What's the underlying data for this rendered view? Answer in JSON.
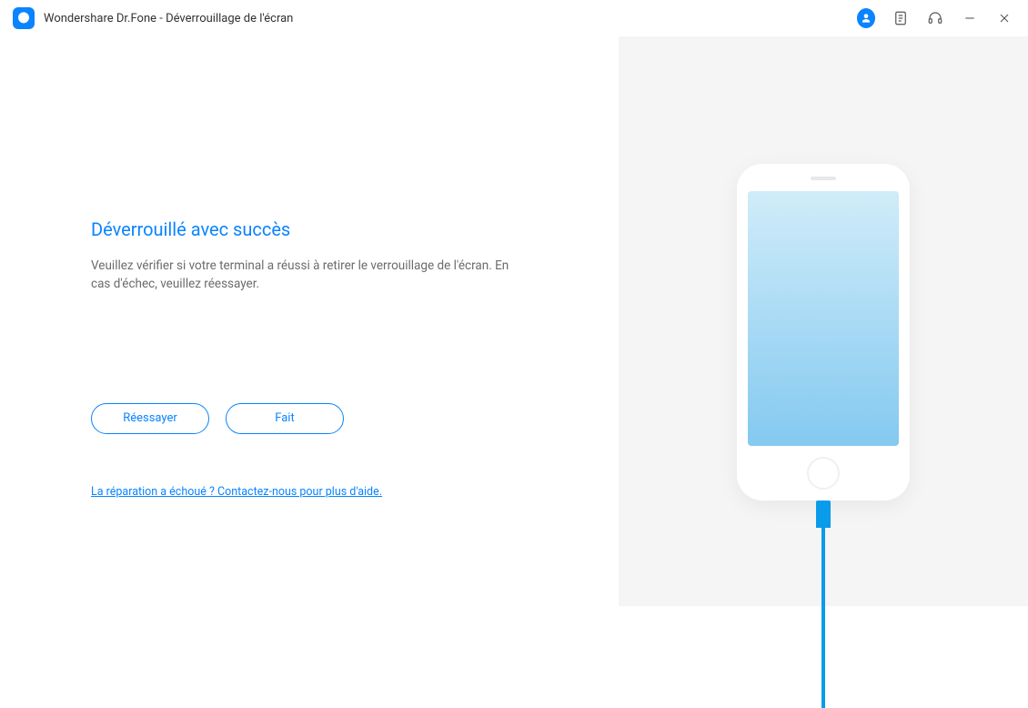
{
  "titlebar": {
    "title": "Wondershare Dr.Fone - Déverrouillage de l'écran"
  },
  "main": {
    "heading": "Déverrouillé avec succès",
    "description": "Veuillez vérifier si votre terminal a réussi à retirer le verrouillage de l'écran. En cas d'échec, veuillez réessayer.",
    "retry_label": "Réessayer",
    "done_label": "Fait",
    "help_link": "La réparation a échoué ? Contactez-nous pour plus d'aide."
  }
}
